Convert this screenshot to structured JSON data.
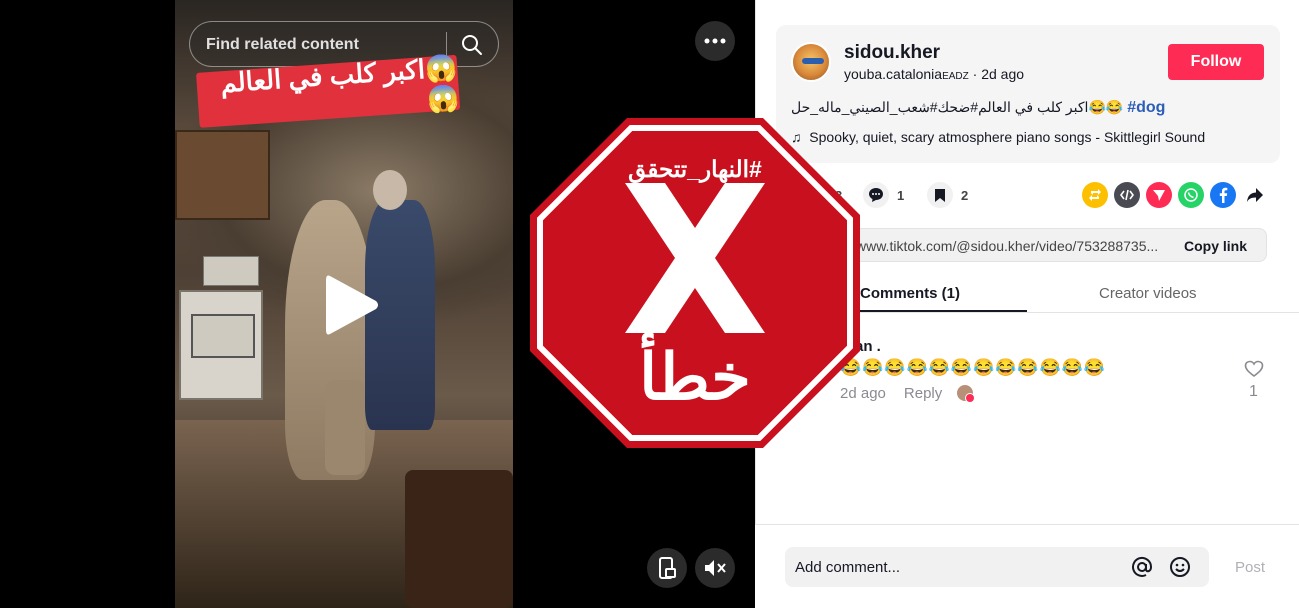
{
  "video": {
    "search_placeholder": "Find related content",
    "caption_text": "😱اكبر كلب في العالم😱"
  },
  "stamp": {
    "hashtag": "#النهار_تتحقق",
    "mark": "X",
    "verdict": "خطأ",
    "color": "#c8101e"
  },
  "author": {
    "username": "sidou.kher",
    "nickname": "youba.catalonia",
    "nickname_suffix": "EADZ",
    "date": " · 2d ago",
    "follow_label": "Follow"
  },
  "post": {
    "description": "اكبر كلب في العالم#ضحك#شعب_الصيني_ماله_حل😂😂",
    "hashtag": "#dog",
    "music_icon": "♫",
    "music": "Spooky, quiet, scary atmosphere piano songs - Skittlegirl Sound"
  },
  "actions": {
    "likes_fragment": "3",
    "comments": "1",
    "saves": "2"
  },
  "link": {
    "url": "www.tiktok.com/@sidou.kher/video/753288735...",
    "copy_label": "Copy link"
  },
  "tabs": {
    "comments": "Comments (1)",
    "creator_videos": "Creator videos"
  },
  "comment": {
    "author": "nran .",
    "text": "😂😂😂😂😂😂😂😂😂😂😂😂",
    "date": "2d ago",
    "reply": "Reply",
    "likes": "1"
  },
  "footer": {
    "placeholder": "Add comment...",
    "post_label": "Post"
  },
  "colors": {
    "accent": "#fe2c55",
    "hashtag": "#2b5db9"
  }
}
